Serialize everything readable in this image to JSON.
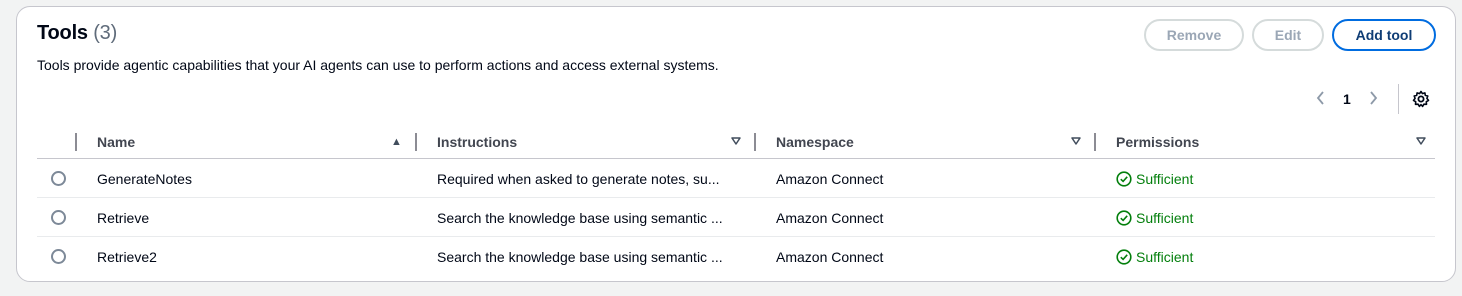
{
  "header": {
    "title": "Tools",
    "count": "(3)",
    "description": "Tools provide agentic capabilities that your AI agents can use to perform actions and access external systems."
  },
  "actions": {
    "remove_label": "Remove",
    "edit_label": "Edit",
    "add_label": "Add tool"
  },
  "pagination": {
    "current_page": "1"
  },
  "table": {
    "columns": [
      {
        "label": "Name",
        "sort": "ascending"
      },
      {
        "label": "Instructions",
        "sort": "none"
      },
      {
        "label": "Namespace",
        "sort": "none"
      },
      {
        "label": "Permissions",
        "sort": "none"
      }
    ],
    "rows": [
      {
        "name": "GenerateNotes",
        "instructions": "Required when asked to generate notes, su...",
        "namespace": "Amazon Connect",
        "permissions": "Sufficient"
      },
      {
        "name": "Retrieve",
        "instructions": "Search the knowledge base using semantic ...",
        "namespace": "Amazon Connect",
        "permissions": "Sufficient"
      },
      {
        "name": "Retrieve2",
        "instructions": "Search the knowledge base using semantic ...",
        "namespace": "Amazon Connect",
        "permissions": "Sufficient"
      }
    ]
  },
  "colors": {
    "accent": "#006ce0",
    "success": "#037f0c",
    "disabled": "#9ba7b6"
  },
  "icons": [
    "chevron-left-icon",
    "chevron-right-icon",
    "settings-gear-icon",
    "sort-ascending-icon",
    "sort-icon",
    "status-check-icon"
  ]
}
